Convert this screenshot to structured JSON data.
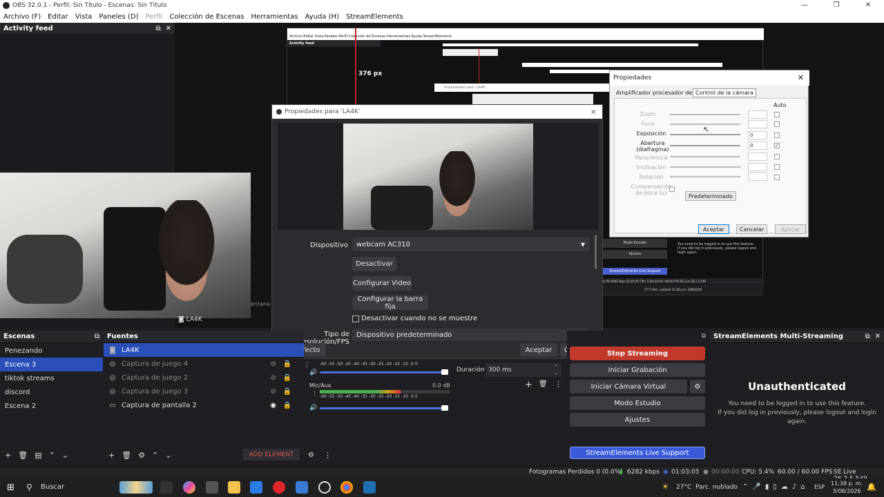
{
  "window": {
    "title": "OBS 32.0.1 - Perfil: Sin Título - Escenas: Sin Título",
    "controls": [
      "—",
      "❐",
      "✕"
    ]
  },
  "menu": [
    "Archivo (F)",
    "Editar",
    "Vista",
    "Paneles (D)",
    "Perfil",
    "Colección de Escenas",
    "Herramientas",
    "Ayuda (H)",
    "StreamElements"
  ],
  "activity_feed": {
    "title": "Activity feed"
  },
  "preview": {
    "px_label": "376 px",
    "source_label": "LA4K",
    "overlay_text": "entana"
  },
  "props_dialog": {
    "title": "Propiedades para 'LA4K'",
    "device_label": "Dispositivo",
    "device_value": "webcam AC310",
    "btn_deactivate": "Desactivar",
    "btn_config_video": "Configurar Video",
    "btn_config_bar": "Configurar la barra fija",
    "checkbox_label": "Desactivar cuando no se muestre",
    "res_label": "Tipo de resolución/FPS",
    "res_value": "Dispositivo predeterminado",
    "defaults": "Por defecto",
    "accept": "Aceptar",
    "cancel": "Cancelar"
  },
  "cam_dialog": {
    "title": "Propiedades",
    "tab1": "Amplificador procesador de vídeo",
    "tab2": "Control de la cámara",
    "auto": "Auto",
    "rows": [
      {
        "label": "Zoom",
        "enabled": false,
        "value": "",
        "auto": false
      },
      {
        "label": "Foco",
        "enabled": false,
        "value": "",
        "auto": false
      },
      {
        "label": "Exposición",
        "enabled": true,
        "value": "0",
        "auto": false
      },
      {
        "label": "Abertura (diafragma)",
        "enabled": true,
        "value": "0",
        "auto": true
      },
      {
        "label": "Panorámica",
        "enabled": false,
        "value": "",
        "auto": false
      },
      {
        "label": "Inclinación",
        "enabled": false,
        "value": "",
        "auto": false
      },
      {
        "label": "Rotación",
        "enabled": false,
        "value": "",
        "auto": false
      }
    ],
    "low_light": "Compensación de poca luz",
    "default_btn": "Predeterminado",
    "accept": "Aceptar",
    "cancel": "Cancelar",
    "apply": "Aplicar"
  },
  "nested": {
    "menu": "Archivo  Editar  Vista  Paneles  Perfil  Colección de Escenas  Herramientas  Ayuda  StreamElements",
    "activity": "Activity feed",
    "props_title": "Propiedades para 'LA4K'",
    "modo": "Modo Estudio",
    "ajustes": "Ajustes",
    "support": "StreamElements Live Support",
    "unauth_1": "You need to be logged in to use this feature.",
    "unauth_2": "If you did log in previously, please logout and login again.",
    "status": "0.0% 6282 kbps  01:03:05  CPU: 5.4%  60.00 / 60.00 FPS  SE.Live 26.2.5.549",
    "taskbar": "27°C  Parc. nublado  11:38 p.m. 3/08/2026"
  },
  "scenes": {
    "title": "Escenas",
    "items": [
      "Penezando",
      "Escena 3",
      "tiktok streams",
      "discord",
      "Escena 2"
    ],
    "selected": 1
  },
  "sources": {
    "title": "Fuentes",
    "items": [
      {
        "label": "LA4K",
        "icon": "camera-icon",
        "active": true
      },
      {
        "label": "Captura de juego 4",
        "icon": "gamepad-icon",
        "active": false
      },
      {
        "label": "Captura de juego 2",
        "icon": "gamepad-icon",
        "active": false
      },
      {
        "label": "Captura de juego 3",
        "icon": "gamepad-icon",
        "active": false
      },
      {
        "label": "Captura de pantalla 2",
        "icon": "monitor-icon",
        "active": true
      }
    ],
    "add_element": "ADD ELEMENT"
  },
  "mixer": {
    "scale": [
      "-60",
      "-55",
      "-50",
      "-45",
      "-40",
      "-35",
      "-30",
      "-25",
      "-20",
      "-15",
      "-10",
      "-5",
      "0"
    ],
    "mic_label": "Mic/Aux",
    "mic_db": "0.0 dB",
    "mic_level": 0.62
  },
  "transitions": {
    "duration_label": "Duración",
    "duration_value": "300 ms"
  },
  "controls": {
    "stop_streaming": "Stop Streaming",
    "start_recording": "Iniciar Grabación",
    "virtual_cam": "Iniciar Cámara Virtual",
    "studio_mode": "Modo Estudio",
    "settings": "Ajustes",
    "live_support": "StreamElements Live Support"
  },
  "se_multi": {
    "title": "StreamElements Multi-Streaming",
    "heading": "Unauthenticated",
    "line1": "You need to be logged in to use this feature.",
    "line2": "If you did log in previously, please logout and login",
    "line3": "again."
  },
  "status": {
    "dropped": "Fotogramas Perdidos 0 (0.0%)",
    "kbps": "6282 kbps",
    "stream_time": "01:03:05",
    "rec_time": "00:00:00",
    "cpu": "CPU: 5.4%",
    "fps": "60.00 / 60.00 FPS",
    "version": "SE.Live 26.2.5.549"
  },
  "taskbar": {
    "search": "Buscar",
    "weather_temp": "27°C",
    "weather_desc": "Parc. nublado",
    "lang": "ESP",
    "time": "11:38 p. m.",
    "date": "3/08/2026"
  },
  "colors": {
    "accent": "#2a4fb8",
    "stream_red": "#c0392b",
    "support_blue": "#3a5bd9"
  }
}
